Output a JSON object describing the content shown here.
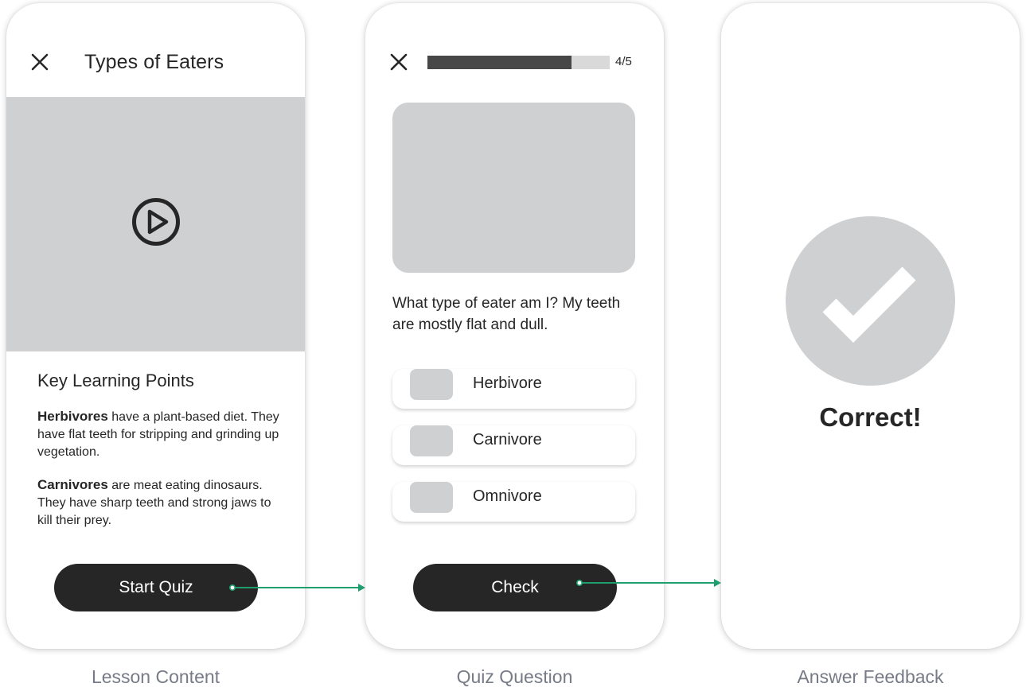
{
  "screens": [
    {
      "title": "Types of Eaters",
      "key_points_heading": "Key Learning Points",
      "points": [
        {
          "term": "Herbivores",
          "text": " have a plant-based diet. They have flat teeth for stripping and grinding up vegetation."
        },
        {
          "term": "Carnivores",
          "text": " are meat eating dinosaurs. They have sharp teeth and strong jaws to kill their prey."
        }
      ],
      "button": "Start Quiz",
      "caption": "Lesson Content"
    },
    {
      "progress_text": "4/5",
      "progress_fraction": 0.79,
      "question": "What type of eater am I? My teeth are mostly flat and dull.",
      "options": [
        "Herbivore",
        "Carnivore",
        "Omnivore"
      ],
      "button": "Check",
      "caption": "Quiz Question"
    },
    {
      "result": "Correct!",
      "caption": "Answer Feedback"
    }
  ],
  "colors": {
    "connector": "#1f9e6e",
    "button_bg": "#262626",
    "placeholder": "#cfd0d2"
  }
}
